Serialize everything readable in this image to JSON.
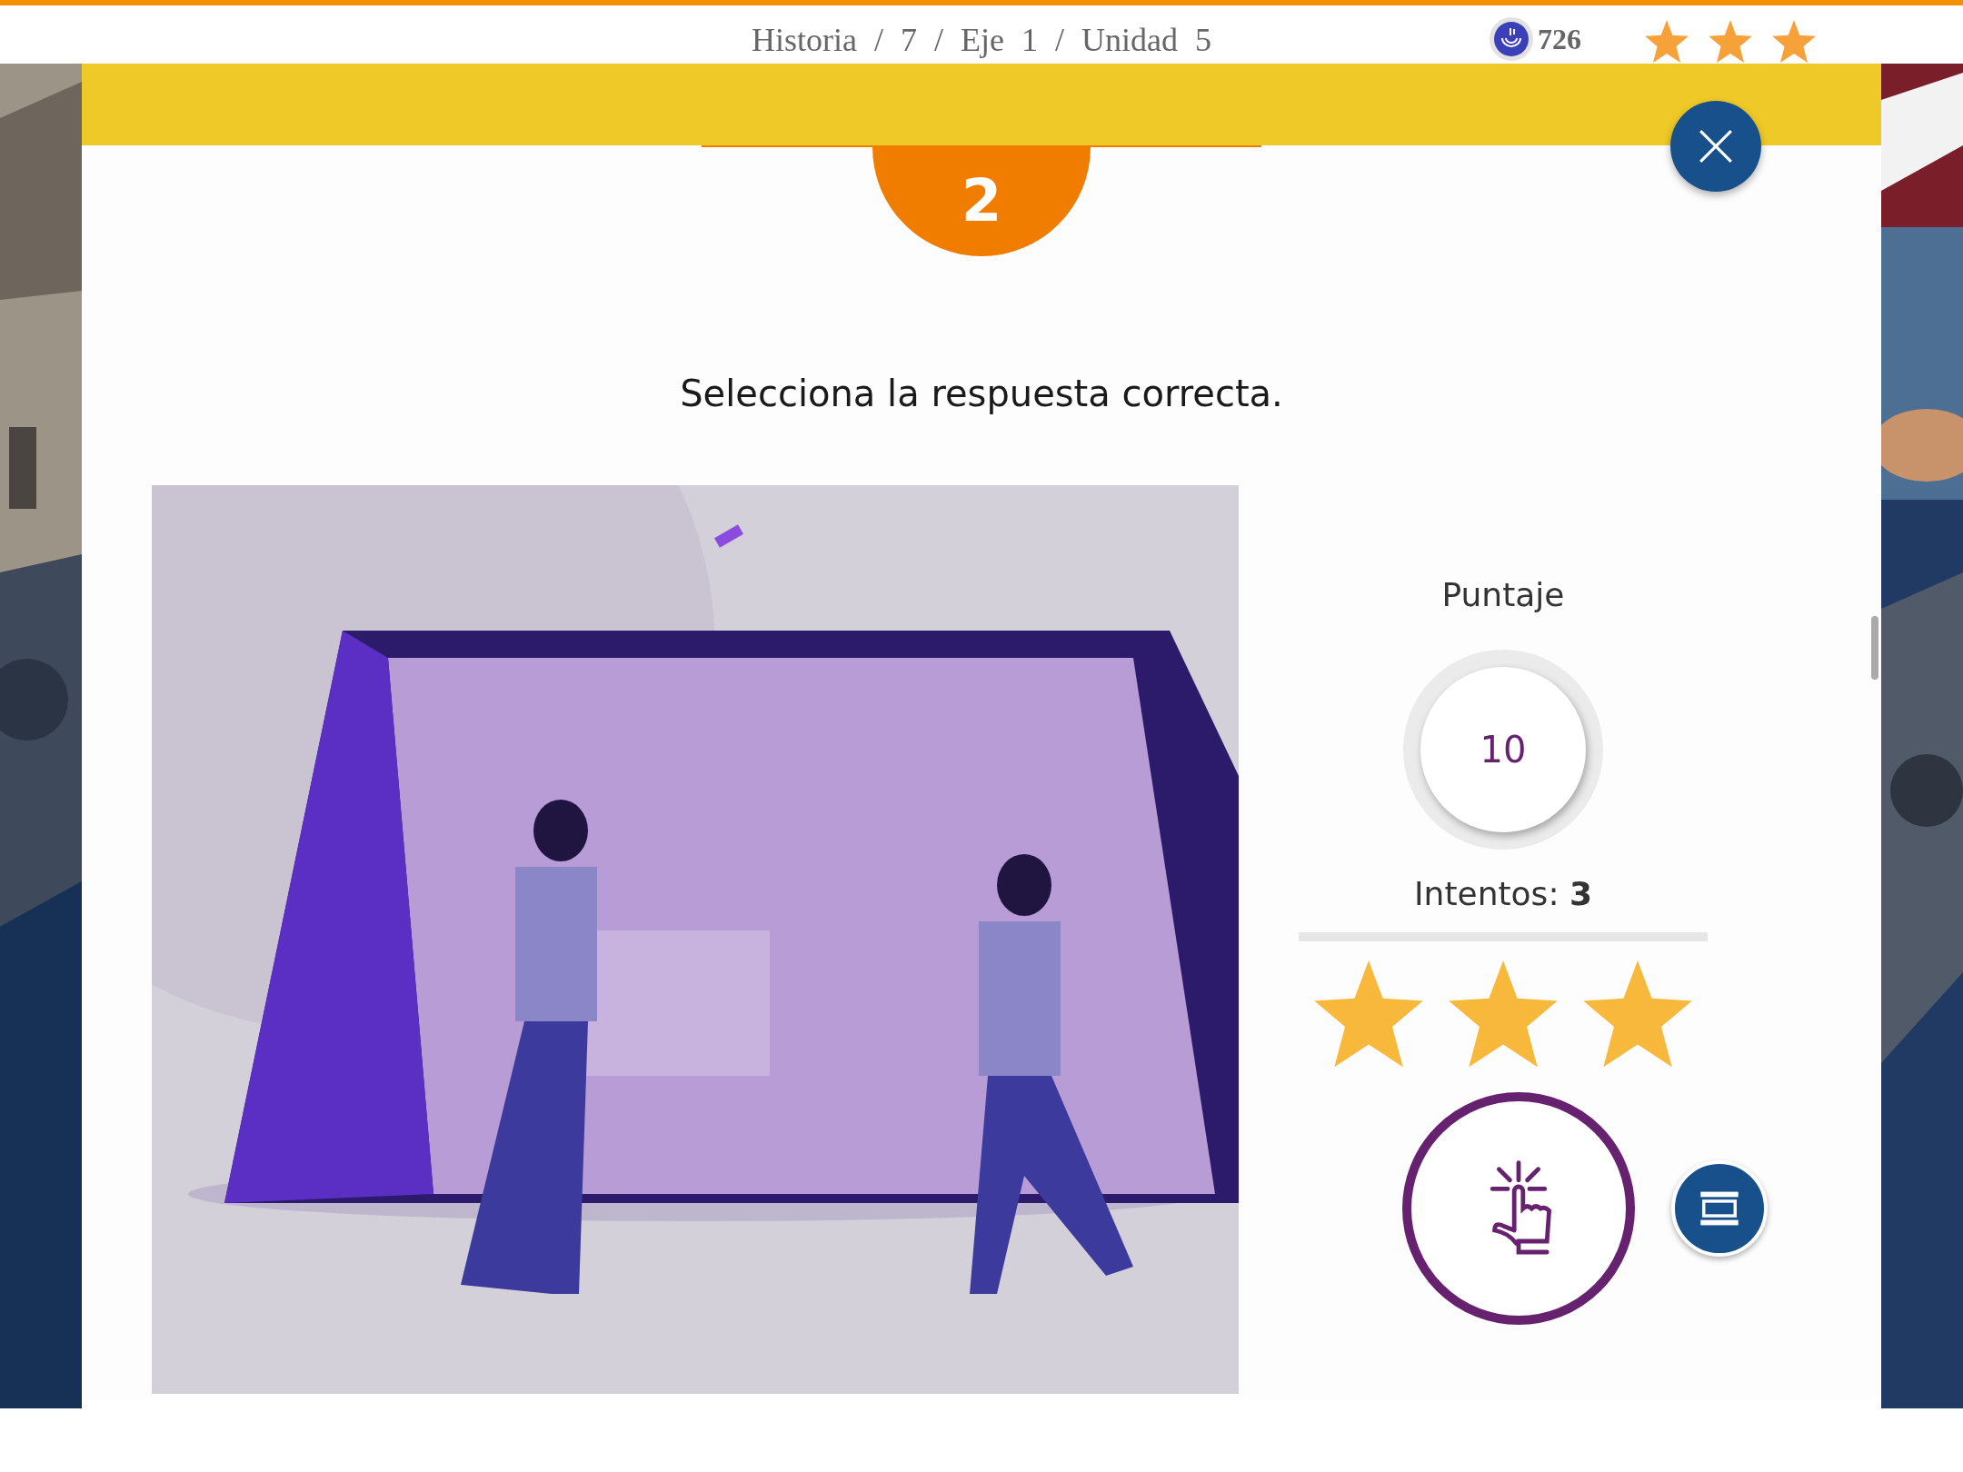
{
  "breadcrumb": "Historia / 7 / Eje 1 / Unidad 5",
  "coins": "726",
  "header_rating": {
    "stars": 3
  },
  "question_number": "2",
  "instruction": "Selecciona la respuesta correcta.",
  "score": {
    "label": "Puntaje",
    "value": "10",
    "attempts": "Intentos: **3**",
    "stars": 3
  }
}
